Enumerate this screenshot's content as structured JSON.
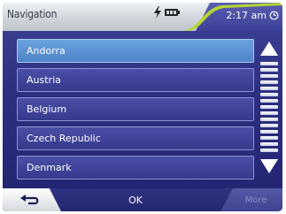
{
  "header": {
    "title": "Navigation",
    "clock": "2:17 am",
    "icons": [
      "charge-icon",
      "battery-icon",
      "alarm-icon"
    ]
  },
  "list": {
    "items": [
      {
        "label": "Andorra",
        "selected": true
      },
      {
        "label": "Austria",
        "selected": false
      },
      {
        "label": "Belgium",
        "selected": false
      },
      {
        "label": "Czech Republic",
        "selected": false
      },
      {
        "label": "Denmark",
        "selected": false
      }
    ]
  },
  "scrollbar": {
    "icons": [
      "arrow-up-icon",
      "arrow-down-icon"
    ]
  },
  "footer": {
    "back_icon": "back-arrow-icon",
    "ok_label": "OK",
    "more_label": "More"
  },
  "colors": {
    "background": "#2c2f80",
    "selected_item": "#5d93d4",
    "accent": "#b7d332",
    "disabled_text": "#8a8ec4"
  }
}
